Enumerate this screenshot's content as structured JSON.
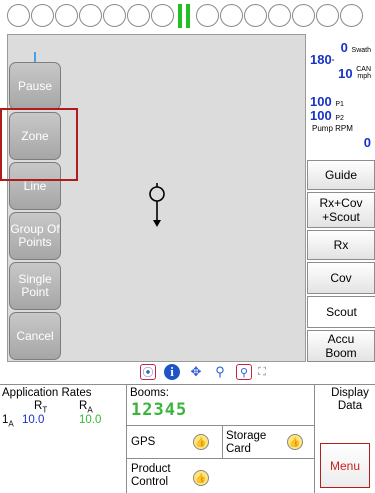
{
  "left_buttons": [
    {
      "label": "Pause"
    },
    {
      "label": "Zone"
    },
    {
      "label": "Line"
    },
    {
      "label": "Group Of Points"
    },
    {
      "label": "Single Point"
    },
    {
      "label": "Cancel"
    }
  ],
  "right_readouts": {
    "swath_value": "0",
    "swath_unit": "Swath",
    "heading_value": "180",
    "heading_unit": "°",
    "speed_value": "10",
    "speed_unit_top": "CAN",
    "speed_unit_bottom": "mph",
    "p1_value": "100",
    "p1_unit": "P1",
    "p2_value": "100",
    "p2_unit": "P2",
    "pump_label": "Pump RPM",
    "pump_value": "0"
  },
  "right_buttons": [
    {
      "label": "Guide"
    },
    {
      "label": "Rx+Cov +Scout"
    },
    {
      "label": "Rx"
    },
    {
      "label": "Cov"
    },
    {
      "label": "Scout"
    },
    {
      "label": "Accu Boom"
    }
  ],
  "toolbar_icons": [
    "gps-icon",
    "info-icon",
    "pan-icon",
    "zoom-icon",
    "zoom-extent-icon",
    "fullscreen-icon"
  ],
  "bottom": {
    "rates_title": "Application Rates",
    "rt_label": "R",
    "rt_sub": "T",
    "ra_label": "R",
    "ra_sub": "A",
    "row_index": "1",
    "row_sub": "A",
    "rt_value": "10.0",
    "ra_value": "10.0",
    "booms_title": "Booms:",
    "boom_numbers": "12345",
    "gps_label": "GPS",
    "storage_label": "Storage Card",
    "product_label": "Product Control",
    "display_data_label": "Display Data",
    "menu_label": "Menu"
  },
  "colors": {
    "accent_blue": "#1732c8",
    "green": "#3bb43b",
    "red": "#d02020"
  }
}
